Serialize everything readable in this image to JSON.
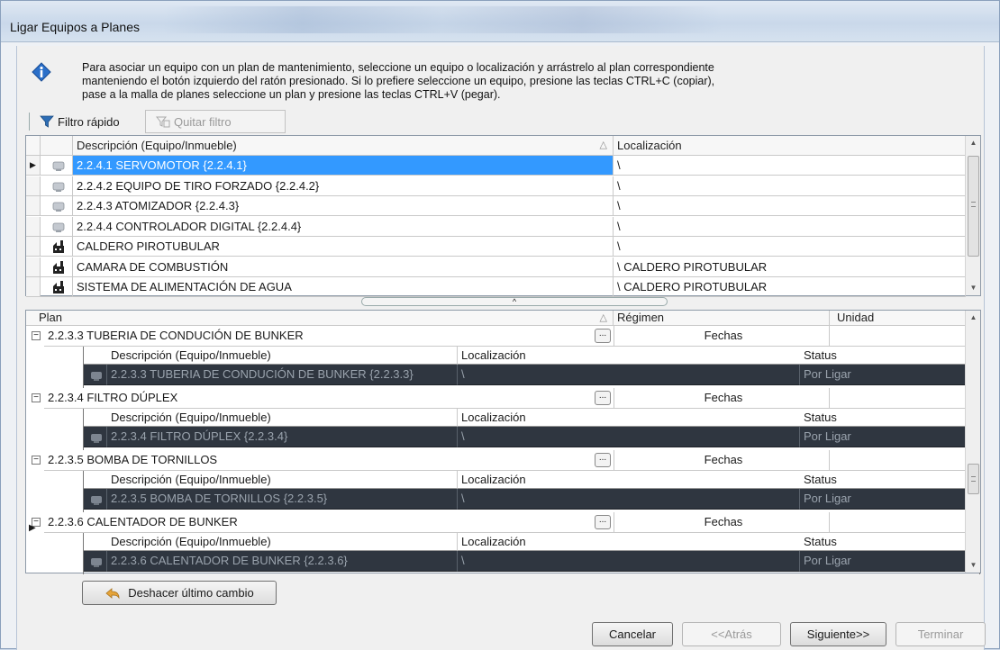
{
  "window": {
    "title": "Ligar Equipos a Planes"
  },
  "info": {
    "lines": [
      "Para asociar un equipo con un plan de mantenimiento, seleccione un equipo o localización y arrástrelo al plan correspondiente",
      "manteniendo el botón izquierdo del ratón presionado. Si lo prefiere seleccione un equipo, presione las teclas CTRL+C (copiar),",
      "pase a la malla de planes seleccione un plan y presione las teclas CTRL+V (pegar)."
    ]
  },
  "toolbar": {
    "quick_filter": "Filtro rápido",
    "remove_filter": "Quitar filtro"
  },
  "equipment_grid": {
    "columns": [
      "Descripción (Equipo/Inmueble)",
      "Localización"
    ],
    "rows": [
      {
        "icon": "equipment",
        "description": "2.2.4.1 SERVOMOTOR {2.2.4.1}",
        "location": "\\"
      },
      {
        "icon": "equipment",
        "description": "2.2.4.2 EQUIPO DE TIRO FORZADO {2.2.4.2}",
        "location": "\\"
      },
      {
        "icon": "equipment",
        "description": "2.2.4.3 ATOMIZADOR {2.2.4.3}",
        "location": "\\"
      },
      {
        "icon": "equipment",
        "description": "2.2.4.4 CONTROLADOR DIGITAL {2.2.4.4}",
        "location": "\\"
      },
      {
        "icon": "building",
        "description": "CALDERO PIROTUBULAR",
        "location": "\\"
      },
      {
        "icon": "building",
        "description": "CAMARA DE COMBUSTIÓN",
        "location": "\\ CALDERO PIROTUBULAR"
      },
      {
        "icon": "building",
        "description": "SISTEMA DE ALIMENTACIÓN DE AGUA",
        "location": "\\ CALDERO PIROTUBULAR"
      }
    ]
  },
  "plans_grid": {
    "columns": [
      "Plan",
      "Régimen",
      "Unidad"
    ],
    "regime_label": "Fechas",
    "sub_columns": [
      "Descripción (Equipo/Inmueble)",
      "Localización",
      "Status"
    ],
    "groups": [
      {
        "plan": "2.2.3.3 TUBERIA DE CONDUCIÓN DE BUNKER",
        "item": {
          "description": "2.2.3.3 TUBERIA DE CONDUCIÓN DE BUNKER {2.2.3.3}",
          "location": "\\",
          "status": "Por Ligar"
        }
      },
      {
        "plan": "2.2.3.4 FILTRO DÚPLEX",
        "item": {
          "description": "2.2.3.4  FILTRO DÚPLEX {2.2.3.4}",
          "location": "\\",
          "status": "Por Ligar"
        }
      },
      {
        "plan": "2.2.3.5 BOMBA DE TORNILLOS",
        "item": {
          "description": "2.2.3.5 BOMBA DE TORNILLOS {2.2.3.5}",
          "location": "\\",
          "status": "Por Ligar"
        }
      },
      {
        "plan": "2.2.3.6 CALENTADOR DE BUNKER",
        "item": {
          "description": "2.2.3.6 CALENTADOR DE BUNKER {2.2.3.6}",
          "location": "\\",
          "status": "Por Ligar"
        }
      }
    ]
  },
  "actions": {
    "undo": "Deshacer último cambio",
    "cancel": "Cancelar",
    "back": "<<Atrás",
    "next": "Siguiente>>",
    "finish": "Terminar"
  },
  "colors": {
    "selection": "#3399ff",
    "sub_row_bg": "#2f3640",
    "info_icon": "#2a6fc9"
  }
}
